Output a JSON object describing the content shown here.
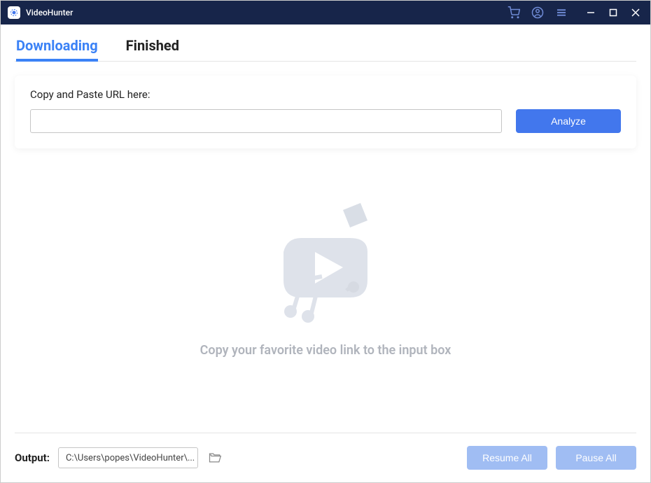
{
  "app": {
    "title": "VideoHunter"
  },
  "tabs": {
    "downloading": "Downloading",
    "finished": "Finished"
  },
  "urlSection": {
    "label": "Copy and Paste URL here:",
    "inputValue": "",
    "analyzeLabel": "Analyze"
  },
  "emptyState": {
    "message": "Copy your favorite video link to the input box"
  },
  "footer": {
    "outputLabel": "Output:",
    "outputPath": "C:\\Users\\popes\\VideoHunter\\...",
    "resumeAllLabel": "Resume All",
    "pauseAllLabel": "Pause All"
  },
  "icons": {
    "cart": "cart-icon",
    "user": "user-icon",
    "menu": "menu-icon",
    "minimize": "minimize-icon",
    "maximize": "maximize-icon",
    "close": "close-icon",
    "folder": "folder-icon"
  }
}
